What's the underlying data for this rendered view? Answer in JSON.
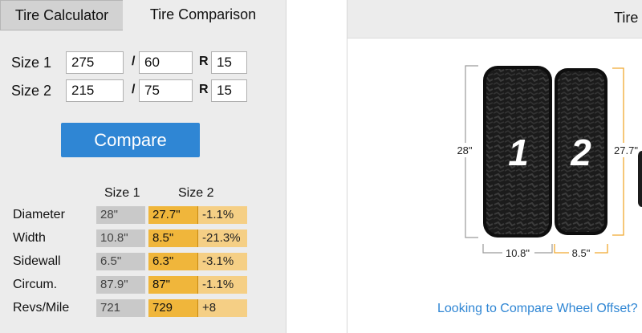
{
  "tabs": [
    {
      "label": "Tire Calculator",
      "active": false
    },
    {
      "label": "Tire Comparison",
      "active": true
    }
  ],
  "inputs": {
    "size1": {
      "label": "Size 1",
      "width": "275",
      "ratio": "60",
      "rim": "15"
    },
    "size2": {
      "label": "Size 2",
      "width": "215",
      "ratio": "75",
      "rim": "15"
    },
    "slash": "/",
    "rim_letter": "R"
  },
  "compare_button": "Compare",
  "results": {
    "col_size1": "Size 1",
    "col_size2": "Size 2",
    "rows": [
      {
        "label": "Diameter",
        "size1": "28\"",
        "size2": "27.7\"",
        "diff": "-1.1%"
      },
      {
        "label": "Width",
        "size1": "10.8\"",
        "size2": "8.5\"",
        "diff": "-21.3%"
      },
      {
        "label": "Sidewall",
        "size1": "6.5\"",
        "size2": "6.3\"",
        "diff": "-3.1%"
      },
      {
        "label": "Circum.",
        "size1": "87.9\"",
        "size2": "87\"",
        "diff": "-1.1%"
      },
      {
        "label": "Revs/Mile",
        "size1": "721",
        "size2": "729",
        "diff": "+8"
      }
    ]
  },
  "visual": {
    "title": "Tire",
    "tire1_number": "1",
    "tire2_number": "2",
    "tire1_diameter": "28\"",
    "tire2_diameter": "27.7\"",
    "tire1_width": "10.8\"",
    "tire2_width": "8.5\"",
    "link": "Looking to Compare Wheel Offset?"
  },
  "colors": {
    "accent_blue": "#2f86d4",
    "size2_orange": "#f0b63b",
    "size2_diff": "#f5cf85",
    "size1_gray": "#c9c9c9"
  }
}
